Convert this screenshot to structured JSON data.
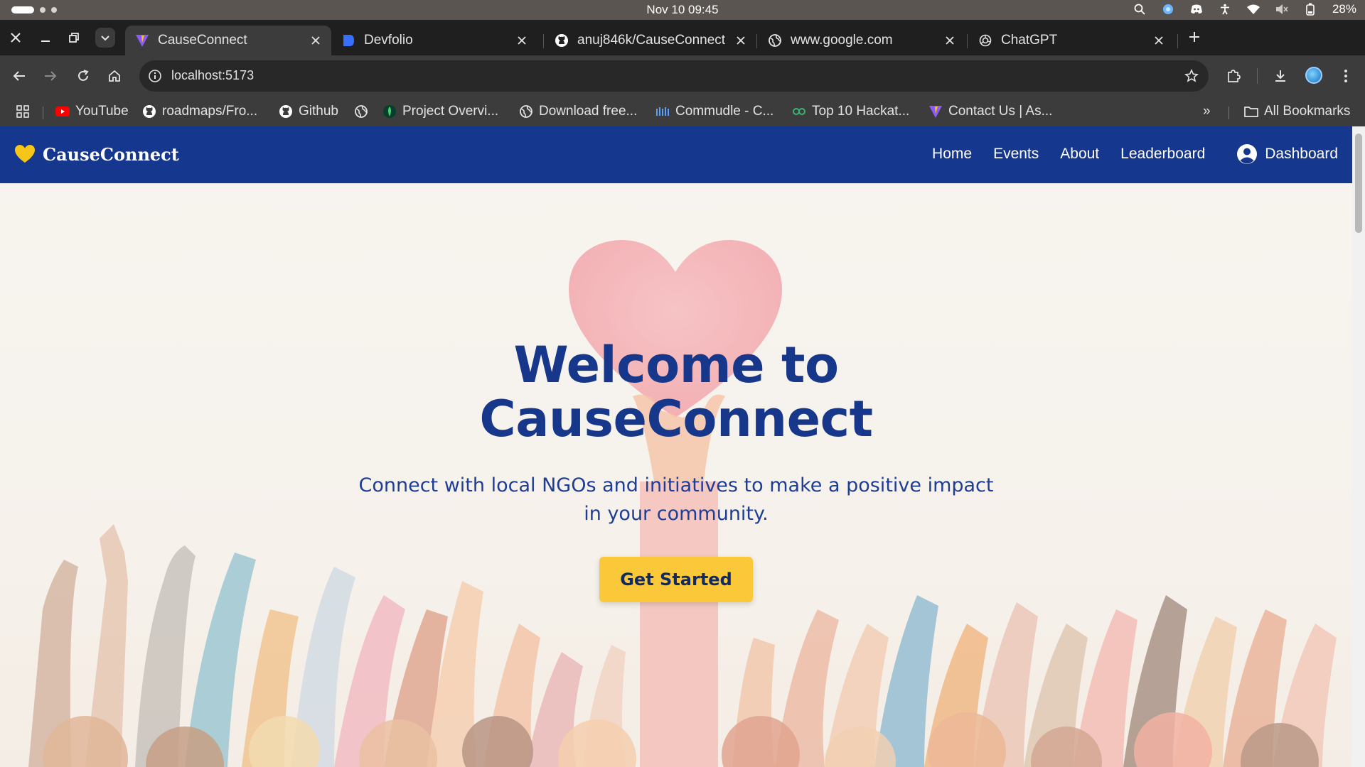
{
  "os_bar": {
    "clock": "Nov 10  09:45",
    "battery": "28%"
  },
  "tabs": [
    {
      "title": "CauseConnect",
      "favicon": "vite-icon",
      "active": true
    },
    {
      "title": "Devfolio",
      "favicon": "devfolio-icon",
      "active": false
    },
    {
      "title": "anuj846k/CauseConnect",
      "favicon": "github-icon",
      "active": false
    },
    {
      "title": "www.google.com",
      "favicon": "globe-icon",
      "active": false
    },
    {
      "title": "ChatGPT",
      "favicon": "chatgpt-icon",
      "active": false
    }
  ],
  "toolbar": {
    "url": "localhost:5173"
  },
  "bookmarks": {
    "items": [
      {
        "label": "YouTube",
        "icon": "youtube-icon"
      },
      {
        "label": "roadmaps/Fro...",
        "icon": "github-icon"
      },
      {
        "label": "Github",
        "icon": "github-icon"
      },
      {
        "label": "",
        "icon": "globe-icon"
      },
      {
        "label": "Project Overvi...",
        "icon": "mongodb-icon"
      },
      {
        "label": "Download free...",
        "icon": "globe-icon"
      },
      {
        "label": "Commudle - C...",
        "icon": "commudle-icon"
      },
      {
        "label": "Top 10 Hackat...",
        "icon": "link-icon"
      },
      {
        "label": "Contact Us | As...",
        "icon": "vite-icon"
      }
    ],
    "all_bookmarks": "All Bookmarks",
    "overflow": "»"
  },
  "site": {
    "brand": "CauseConnect",
    "nav": {
      "home": "Home",
      "events": "Events",
      "about": "About",
      "leaderboard": "Leaderboard",
      "dashboard": "Dashboard"
    },
    "hero": {
      "title_line1": "Welcome to",
      "title_line2": "CauseConnect",
      "subtitle": "Connect with local NGOs and initiatives to make a positive impact in your community.",
      "cta": "Get Started"
    }
  },
  "colors": {
    "nav_bg": "#15378d",
    "title": "#17378a",
    "cta_bg": "#fbc83a",
    "heart": "#f5c518"
  }
}
